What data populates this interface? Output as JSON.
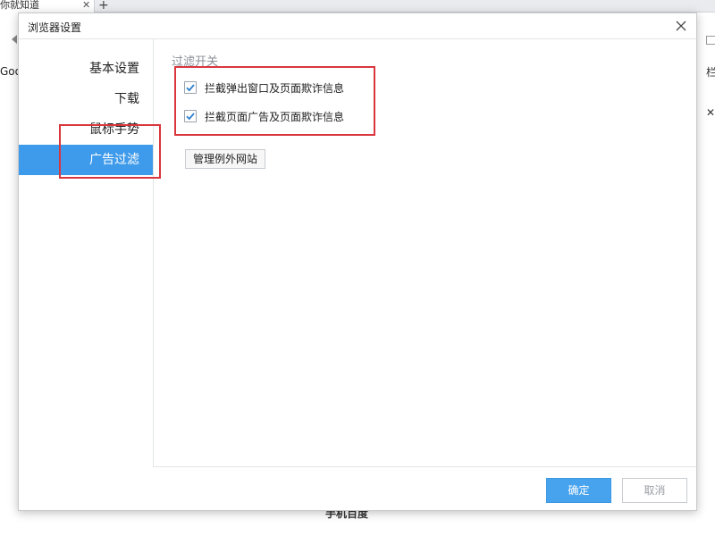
{
  "background": {
    "tab_title": "你就知道",
    "tab_close": "✕",
    "new_tab": "+",
    "google_label": "Goo",
    "right_menu": "栏",
    "right_close": "✕",
    "bottom_text": "手机百度"
  },
  "dialog": {
    "title": "浏览器设置",
    "close_icon": "close-icon"
  },
  "sidebar": {
    "items": [
      {
        "label": "基本设置",
        "active": false
      },
      {
        "label": "下载",
        "active": false
      },
      {
        "label": "鼠标手势",
        "active": false
      },
      {
        "label": "广告过滤",
        "active": true
      }
    ]
  },
  "content": {
    "group_label": "过滤开关",
    "options": [
      {
        "label": "拦截弹出窗口及页面欺诈信息",
        "checked": true
      },
      {
        "label": "拦截页面广告及页面欺诈信息",
        "checked": true
      }
    ],
    "exception_button": "管理例外网站"
  },
  "footer": {
    "ok_label": "确定",
    "cancel_label": "取消"
  },
  "colors": {
    "accent": "#3e9aea",
    "highlight": "#d9363e"
  }
}
